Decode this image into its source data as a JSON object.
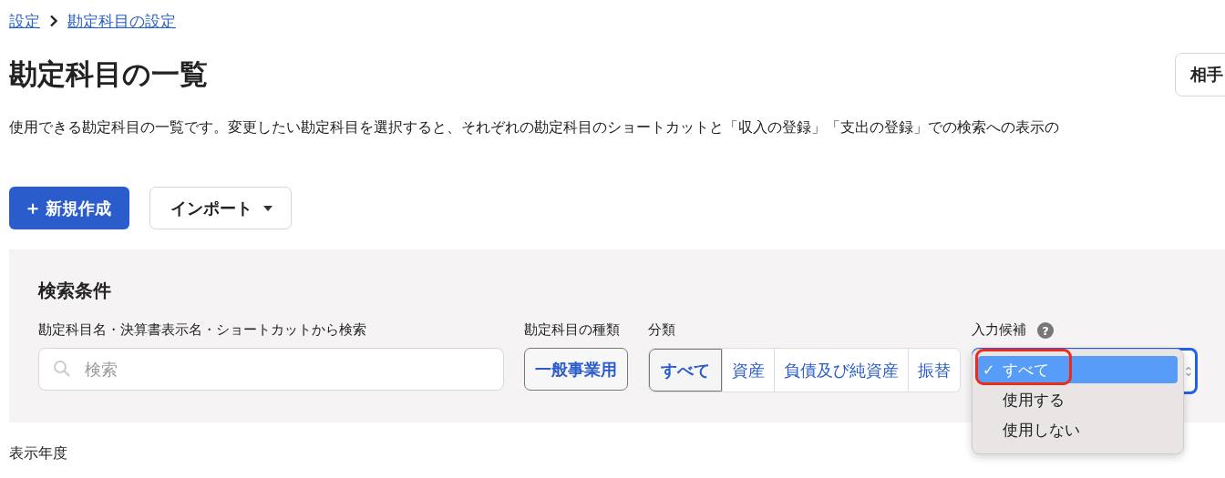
{
  "breadcrumb": [
    {
      "label": "設定"
    },
    {
      "label": "勘定科目の設定"
    }
  ],
  "title": "勘定科目の一覧",
  "header_button": {
    "label": "相手"
  },
  "description": "使用できる勘定科目の一覧です。変更したい勘定科目を選択すると、それぞれの勘定科目のショートカットと「収入の登録」「支出の登録」での検索への表示の",
  "actions": {
    "create": {
      "icon": "＋",
      "label": "新規作成"
    },
    "import": {
      "label": "インポート"
    }
  },
  "search_panel": {
    "title": "検索条件",
    "keyword": {
      "label": "勘定科目名・決算書表示名・ショートカットから検索",
      "placeholder": "検索"
    },
    "account_type": {
      "label": "勘定科目の種類",
      "value": "一般事業用"
    },
    "category": {
      "label": "分類",
      "options": [
        {
          "label": "すべて",
          "selected": true
        },
        {
          "label": "資産",
          "selected": false
        },
        {
          "label": "負債及び純資産",
          "selected": false
        },
        {
          "label": "振替",
          "selected": false
        }
      ]
    },
    "input_candidate": {
      "label": "入力候補",
      "help": "?",
      "menu": [
        {
          "label": "すべて",
          "selected": true,
          "check": "✓"
        },
        {
          "label": "使用する",
          "selected": false
        },
        {
          "label": "使用しない",
          "selected": false
        }
      ]
    }
  },
  "fiscal_year": {
    "label": "表示年度"
  }
}
